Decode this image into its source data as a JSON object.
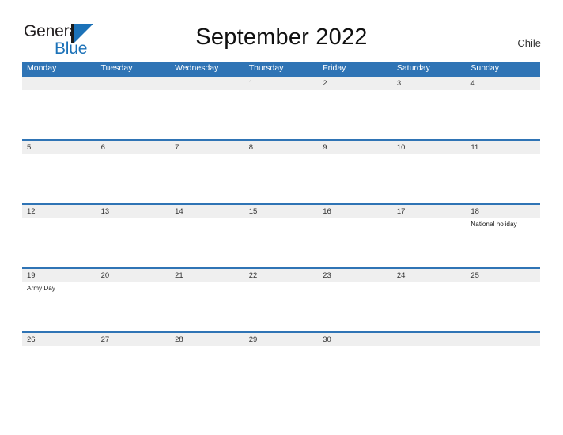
{
  "brand": {
    "name_part1": "General",
    "name_part2": "Blue",
    "mark_icon": "triangle-play-icon",
    "accent_color": "#1c72b8"
  },
  "header": {
    "title": "September 2022",
    "country": "Chile"
  },
  "colors": {
    "header_blue": "#2f74b5",
    "row_band_gray": "#efefef",
    "text_dark": "#333333",
    "brand_blue": "#1c72b8"
  },
  "calendar": {
    "month": "September",
    "year": "2022",
    "weekday_headers": [
      "Monday",
      "Tuesday",
      "Wednesday",
      "Thursday",
      "Friday",
      "Saturday",
      "Sunday"
    ],
    "weeks": [
      [
        {
          "day": "",
          "event": ""
        },
        {
          "day": "",
          "event": ""
        },
        {
          "day": "",
          "event": ""
        },
        {
          "day": "1",
          "event": ""
        },
        {
          "day": "2",
          "event": ""
        },
        {
          "day": "3",
          "event": ""
        },
        {
          "day": "4",
          "event": ""
        }
      ],
      [
        {
          "day": "5",
          "event": ""
        },
        {
          "day": "6",
          "event": ""
        },
        {
          "day": "7",
          "event": ""
        },
        {
          "day": "8",
          "event": ""
        },
        {
          "day": "9",
          "event": ""
        },
        {
          "day": "10",
          "event": ""
        },
        {
          "day": "11",
          "event": ""
        }
      ],
      [
        {
          "day": "12",
          "event": ""
        },
        {
          "day": "13",
          "event": ""
        },
        {
          "day": "14",
          "event": ""
        },
        {
          "day": "15",
          "event": ""
        },
        {
          "day": "16",
          "event": ""
        },
        {
          "day": "17",
          "event": ""
        },
        {
          "day": "18",
          "event": "National holiday"
        }
      ],
      [
        {
          "day": "19",
          "event": "Army Day"
        },
        {
          "day": "20",
          "event": ""
        },
        {
          "day": "21",
          "event": ""
        },
        {
          "day": "22",
          "event": ""
        },
        {
          "day": "23",
          "event": ""
        },
        {
          "day": "24",
          "event": ""
        },
        {
          "day": "25",
          "event": ""
        }
      ],
      [
        {
          "day": "26",
          "event": ""
        },
        {
          "day": "27",
          "event": ""
        },
        {
          "day": "28",
          "event": ""
        },
        {
          "day": "29",
          "event": ""
        },
        {
          "day": "30",
          "event": ""
        },
        {
          "day": "",
          "event": ""
        },
        {
          "day": "",
          "event": ""
        }
      ]
    ]
  }
}
